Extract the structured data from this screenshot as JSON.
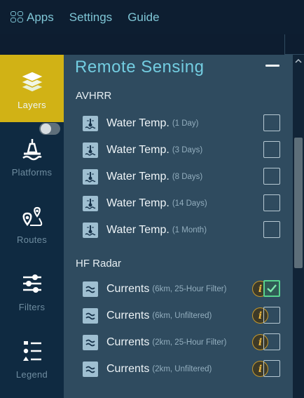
{
  "topbar": {
    "apps_label": "Apps",
    "settings_label": "Settings",
    "guide_label": "Guide"
  },
  "sidebar": {
    "tabs": [
      {
        "label": "Layers",
        "icon": "layers-icon",
        "active": true
      },
      {
        "label": "Platforms",
        "icon": "buoy-icon",
        "active": false
      },
      {
        "label": "Routes",
        "icon": "route-icon",
        "active": false
      },
      {
        "label": "Filters",
        "icon": "sliders-icon",
        "active": false
      },
      {
        "label": "Legend",
        "icon": "legend-icon",
        "active": false
      }
    ],
    "platforms_toggle": false
  },
  "panel": {
    "title": "Remote Sensing",
    "sections": [
      {
        "title": "AVHRR",
        "items": [
          {
            "name": "Water Temp.",
            "detail": "(1 Day)",
            "checked": false,
            "info": false
          },
          {
            "name": "Water Temp.",
            "detail": "(3 Days)",
            "checked": false,
            "info": false
          },
          {
            "name": "Water Temp.",
            "detail": "(8 Days)",
            "checked": false,
            "info": false
          },
          {
            "name": "Water Temp.",
            "detail": "(14 Days)",
            "checked": false,
            "info": false
          },
          {
            "name": "Water Temp.",
            "detail": "(1 Month)",
            "checked": false,
            "info": false
          }
        ]
      },
      {
        "title": "HF Radar",
        "items": [
          {
            "name": "Currents",
            "detail": "(6km, 25-Hour Filter)",
            "checked": true,
            "info": true
          },
          {
            "name": "Currents",
            "detail": "(6km, Unfiltered)",
            "checked": false,
            "info": true
          },
          {
            "name": "Currents",
            "detail": "(2km, 25-Hour Filter)",
            "checked": false,
            "info": true
          },
          {
            "name": "Currents",
            "detail": "(2km, Unfiltered)",
            "checked": false,
            "info": true
          }
        ]
      }
    ],
    "info_glyph": "i"
  },
  "colors": {
    "accent": "#73cde1",
    "active_tab": "#d1b215",
    "checked": "#58d38f",
    "info": "#e8b53e"
  }
}
